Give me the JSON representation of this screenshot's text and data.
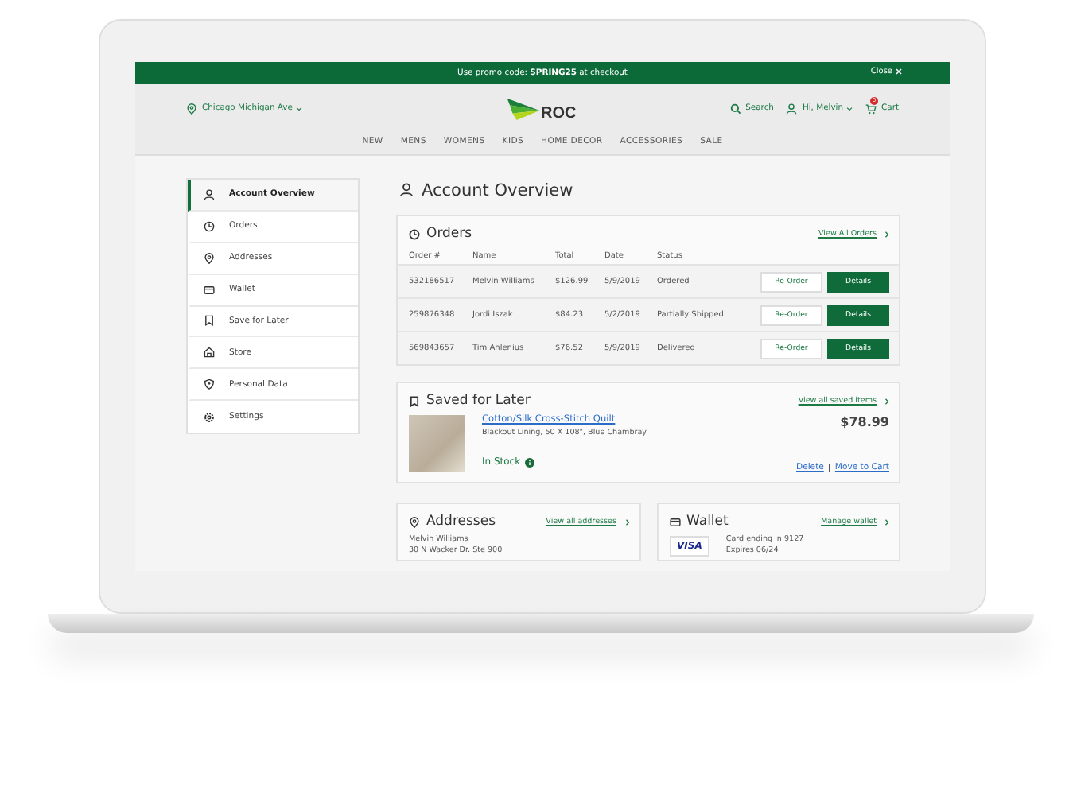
{
  "promo": {
    "text": "Use promo code: **SPRING25** at checkout",
    "close": "Close"
  },
  "header": {
    "location": "Chicago Michigan Ave",
    "logo": "ROC",
    "search": "Search",
    "user": "Hi, Melvin",
    "cart": "Cart",
    "cart_count": "0"
  },
  "nav": [
    "NEW",
    "MENS",
    "WOMENS",
    "KIDS",
    "HOME DECOR",
    "ACCESSORIES",
    "SALE"
  ],
  "sidebar": {
    "items": [
      {
        "label": "Account Overview",
        "selected": true
      },
      {
        "label": "Orders",
        "selected": false
      },
      {
        "label": "Addresses",
        "selected": false
      },
      {
        "label": "Wallet",
        "selected": false
      },
      {
        "label": "Save for Later",
        "selected": false
      },
      {
        "label": "Store",
        "selected": false
      },
      {
        "label": "Personal Data",
        "selected": false
      },
      {
        "label": "Settings",
        "selected": false
      }
    ]
  },
  "page_title": "Account Overview",
  "orders": {
    "title": "Orders",
    "link": "View All Orders",
    "columns": [
      "Order #",
      "Name",
      "Total",
      "Date",
      "Status"
    ],
    "rows": [
      {
        "cells": [
          "532186517",
          "Melvin Williams",
          "$126.99",
          "5/9/2019",
          "Ordered"
        ],
        "reorder": "Re-Order",
        "details": "Details"
      },
      {
        "cells": [
          "259876348",
          "Jordi Iszak",
          "$84.23",
          "5/2/2019",
          "Partially Shipped"
        ],
        "reorder": "Re-Order",
        "details": "Details"
      },
      {
        "cells": [
          "569843657",
          "Tim Ahlenius",
          "$76.52",
          "5/9/2019",
          "Delivered"
        ],
        "reorder": "Re-Order",
        "details": "Details"
      }
    ]
  },
  "saved": {
    "title": "Saved for Later",
    "link": "View all saved items",
    "item": {
      "name": "Cotton/Silk Cross-Stitch Quilt",
      "description": "Blackout Lining, 50 X 108\", Blue Chambray",
      "price": "$78.99",
      "stock": "In Stock",
      "delete": "Delete",
      "move": "Move to Cart"
    }
  },
  "addresses": {
    "title": "Addresses",
    "link": "View all addresses",
    "lines": [
      "Melvin Williams",
      "30 N Wacker Dr. Ste 900"
    ]
  },
  "wallet": {
    "title": "Wallet",
    "link": "Manage wallet",
    "card_brand": "VISA",
    "lines": [
      "Card ending in 9127",
      "Expires 06/24"
    ]
  }
}
